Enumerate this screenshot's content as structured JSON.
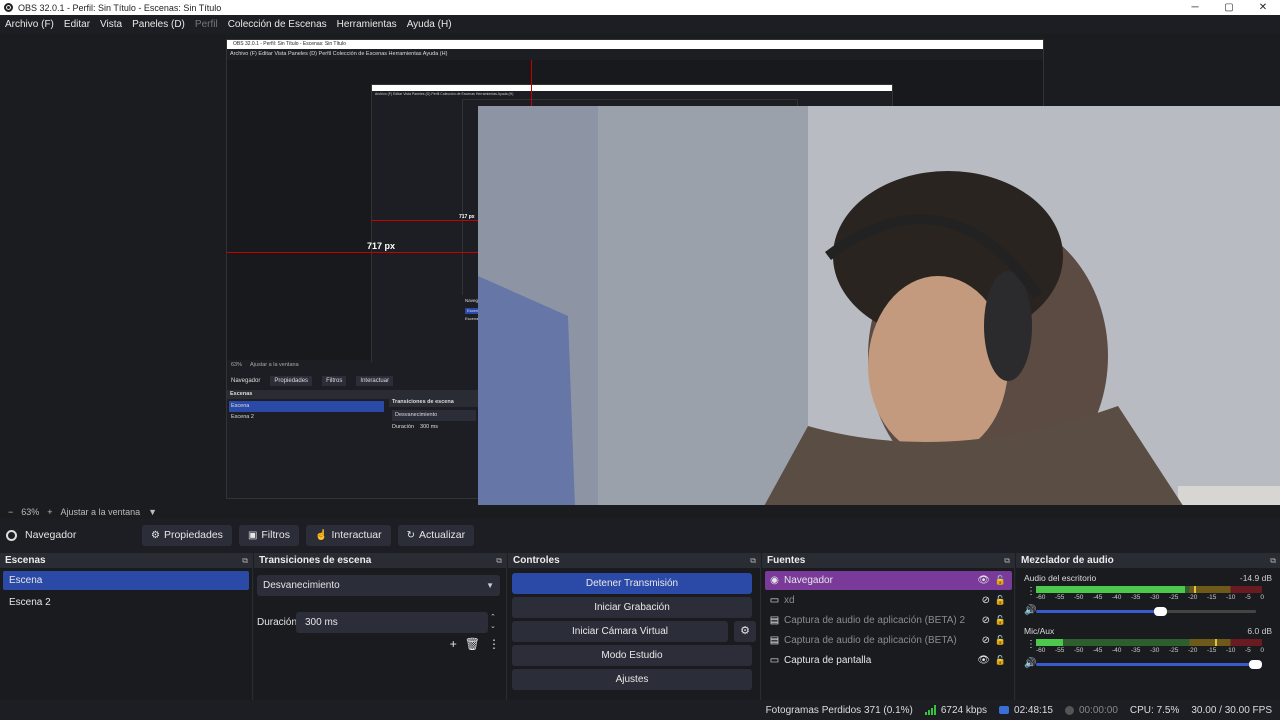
{
  "window": {
    "title": "OBS 32.0.1 - Perfil: Sin Título - Escenas: Sin Título",
    "controls": [
      "─",
      "▢",
      "✕"
    ]
  },
  "menu": [
    {
      "label": "Archivo (F)",
      "enabled": true
    },
    {
      "label": "Editar",
      "enabled": true
    },
    {
      "label": "Vista",
      "enabled": true
    },
    {
      "label": "Paneles (D)",
      "enabled": true
    },
    {
      "label": "Perfil",
      "enabled": false
    },
    {
      "label": "Colección de Escenas",
      "enabled": true
    },
    {
      "label": "Herramientas",
      "enabled": true
    },
    {
      "label": "Ayuda (H)",
      "enabled": true
    }
  ],
  "preview": {
    "nested_title": "OBS 32.0.1 - Perfil: Sin Título - Escenas: Sin Título",
    "nested_menu": "Archivo (F)   Editar   Vista   Paneles (D)   Perfil   Colección de Escenas   Herramientas   Ayuda (H)",
    "measure_label": "717 px",
    "measure_label_small": "717 px",
    "nested_zoom": "63%",
    "nested_fit": "Ajustar a la ventana",
    "nested_source": "Navegador",
    "nested_props": "Propiedades",
    "nested_filters": "Filtros",
    "nested_interact": "Interactuar",
    "nested_scenes_title": "Escenas",
    "nested_scene1": "Escena",
    "nested_scene2": "Escena 2",
    "nested_trans_title": "Transiciones de escena",
    "nested_trans": "Desvanecimiento",
    "nested_duration": "Duración",
    "nested_duration_val": "300 ms",
    "camera_description_icon": "webcam-person"
  },
  "zoom": {
    "minus": "−",
    "value": "63%",
    "plus": "+",
    "fit": "Ajustar a la ventana",
    "arrow": "▼"
  },
  "source_toolbar": {
    "name": "Navegador",
    "properties": "Propiedades",
    "filters": "Filtros",
    "interact": "Interactuar",
    "refresh": "Actualizar"
  },
  "scenes": {
    "title": "Escenas",
    "items": [
      {
        "label": "Escena",
        "selected": true
      },
      {
        "label": "Escena 2",
        "selected": false
      }
    ]
  },
  "transitions": {
    "title": "Transiciones de escena",
    "selected": "Desvanecimiento",
    "duration_label": "Duración",
    "duration_value": "300 ms"
  },
  "controls": {
    "title": "Controles",
    "stop_stream": "Detener Transmisión",
    "start_recording": "Iniciar Grabación",
    "start_virtual_cam": "Iniciar Cámara Virtual",
    "studio_mode": "Modo Estudio",
    "settings": "Ajustes"
  },
  "sources": {
    "title": "Fuentes",
    "items": [
      {
        "label": "Navegador",
        "icon": "globe-icon",
        "selected": true,
        "visible": true
      },
      {
        "label": "xd",
        "icon": "monitor-icon",
        "selected": false,
        "visible": false
      },
      {
        "label": "Captura de audio de aplicación (BETA) 2",
        "icon": "app-audio-icon",
        "selected": false,
        "visible": false
      },
      {
        "label": "Captura de audio de aplicación (BETA)",
        "icon": "app-audio-icon",
        "selected": false,
        "visible": false
      },
      {
        "label": "Captura de pantalla",
        "icon": "monitor-icon",
        "selected": false,
        "visible": true
      }
    ]
  },
  "mixer": {
    "title": "Mezclador de audio",
    "channels": [
      {
        "name": "Audio del escritorio",
        "db": "-14.9 dB",
        "level": 0.66,
        "peak": 0.7,
        "volume": 0.57
      },
      {
        "name": "Mic/Aux",
        "db": "6.0 dB",
        "level": 0.12,
        "peak": 0.79,
        "volume": 1.0
      }
    ],
    "ticks": [
      "-60",
      "-55",
      "-50",
      "-45",
      "-40",
      "-35",
      "-30",
      "-25",
      "-20",
      "-15",
      "-10",
      "-5",
      "0"
    ]
  },
  "status": {
    "dropped_frames": "Fotogramas Perdidos 371 (0.1%)",
    "bitrate": "6724 kbps",
    "stream_time": "02:48:15",
    "rec_time": "00:00:00",
    "cpu": "CPU: 7.5%",
    "fps": "30.00 / 30.00 FPS"
  },
  "colors": {
    "accent": "#2b4aa8",
    "source_selected": "#7a3a9a",
    "live": "#3a6fd8"
  }
}
